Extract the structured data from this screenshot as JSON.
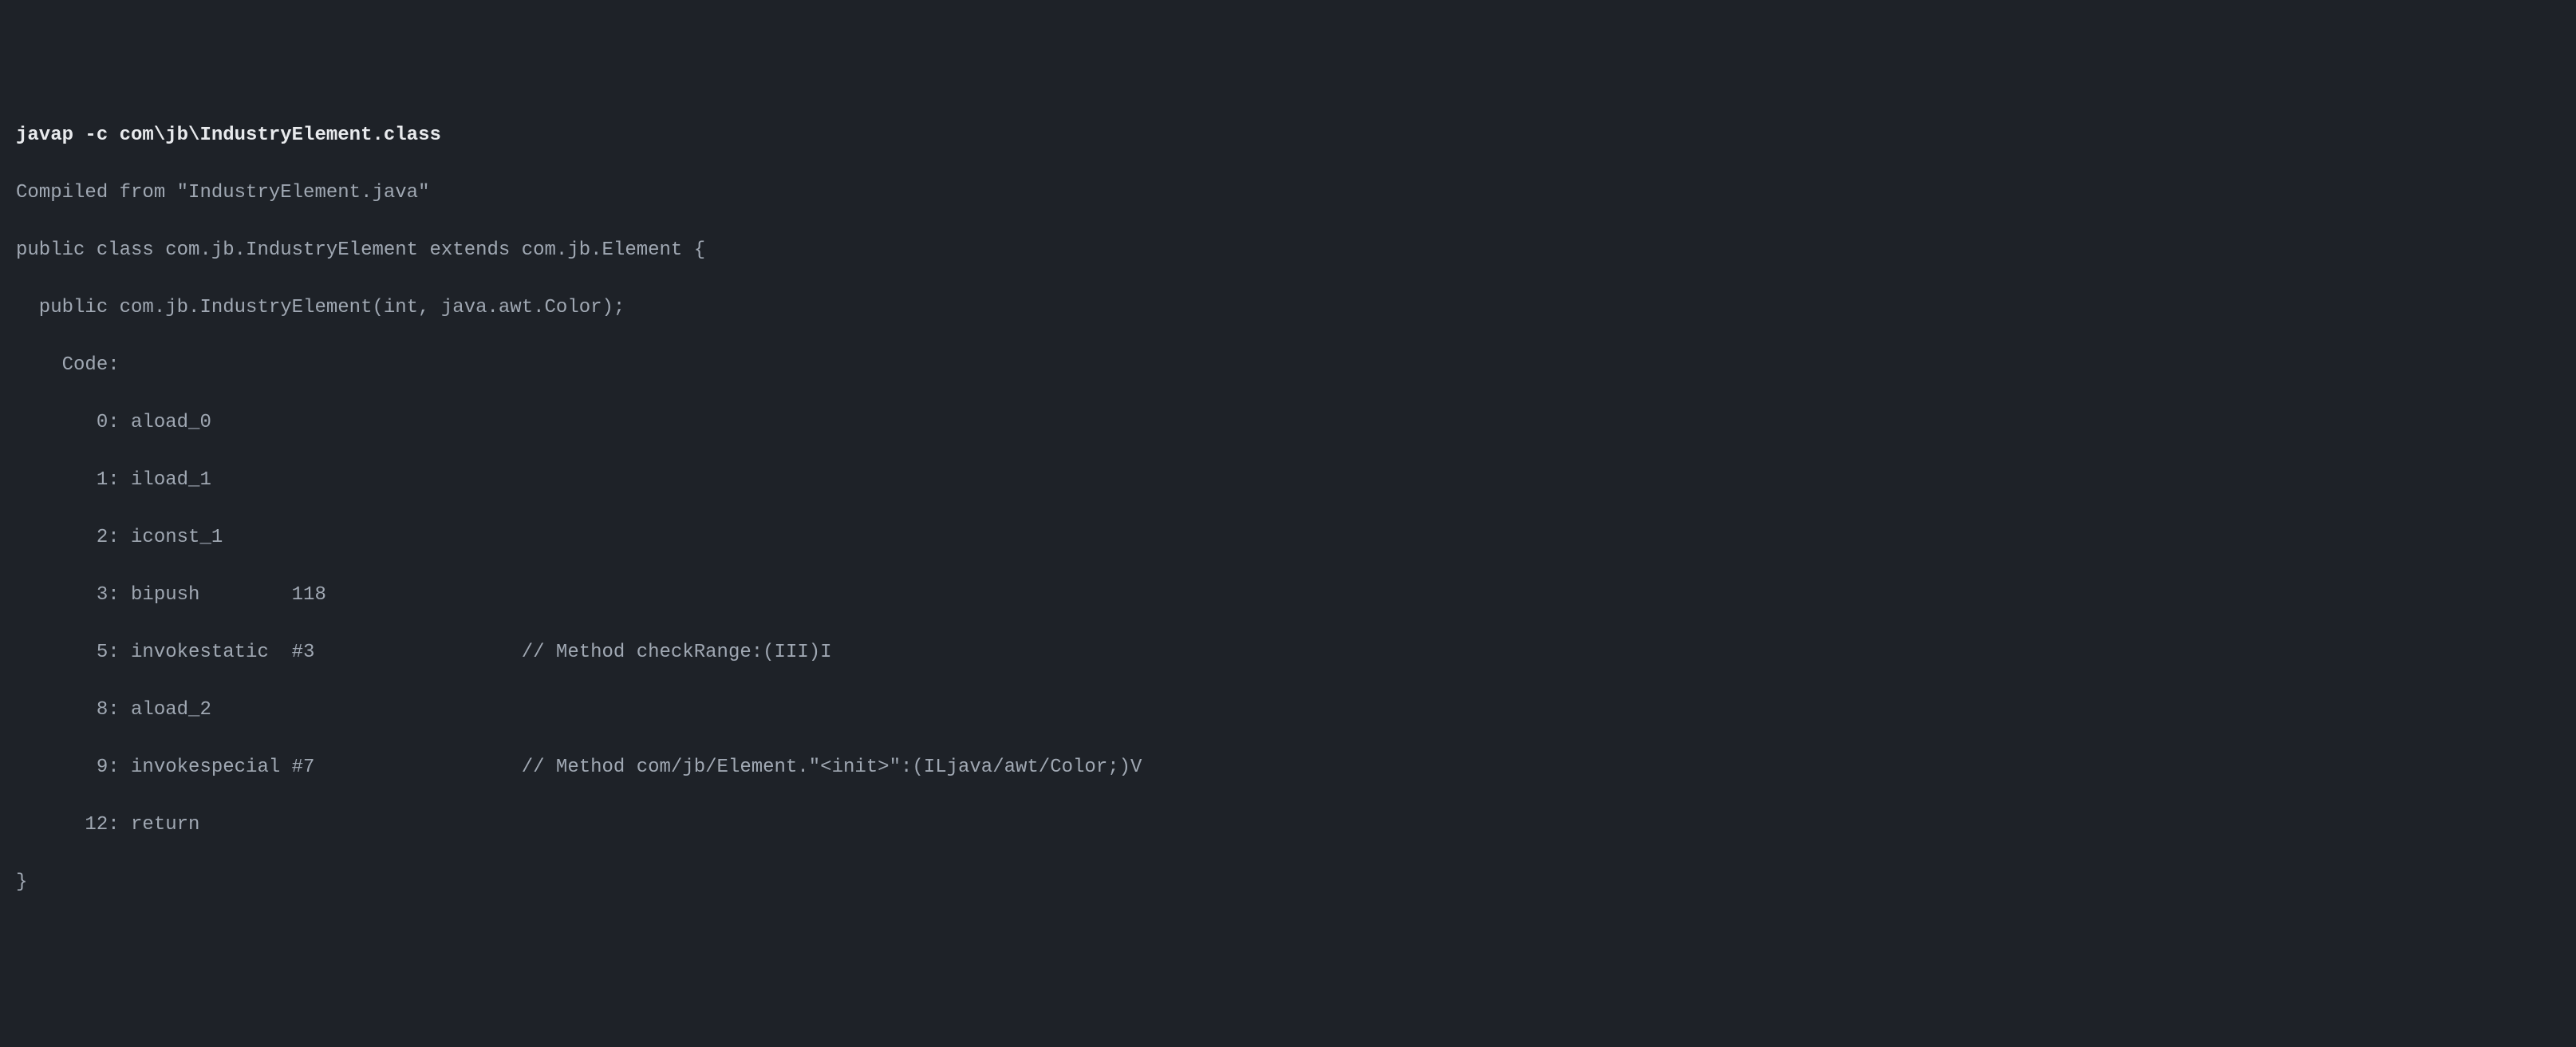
{
  "terminal": {
    "command": "javap -c com\\jb\\IndustryElement.class",
    "lines": [
      "Compiled from \"IndustryElement.java\"",
      "public class com.jb.IndustryElement extends com.jb.Element {",
      "  public com.jb.IndustryElement(int, java.awt.Color);",
      "    Code:",
      "       0: aload_0",
      "       1: iload_1",
      "       2: iconst_1",
      "       3: bipush        118",
      "       5: invokestatic  #3                  // Method checkRange:(III)I",
      "       8: aload_2",
      "       9: invokespecial #7                  // Method com/jb/Element.\"<init>\":(ILjava/awt/Color;)V",
      "      12: return",
      "}"
    ]
  }
}
